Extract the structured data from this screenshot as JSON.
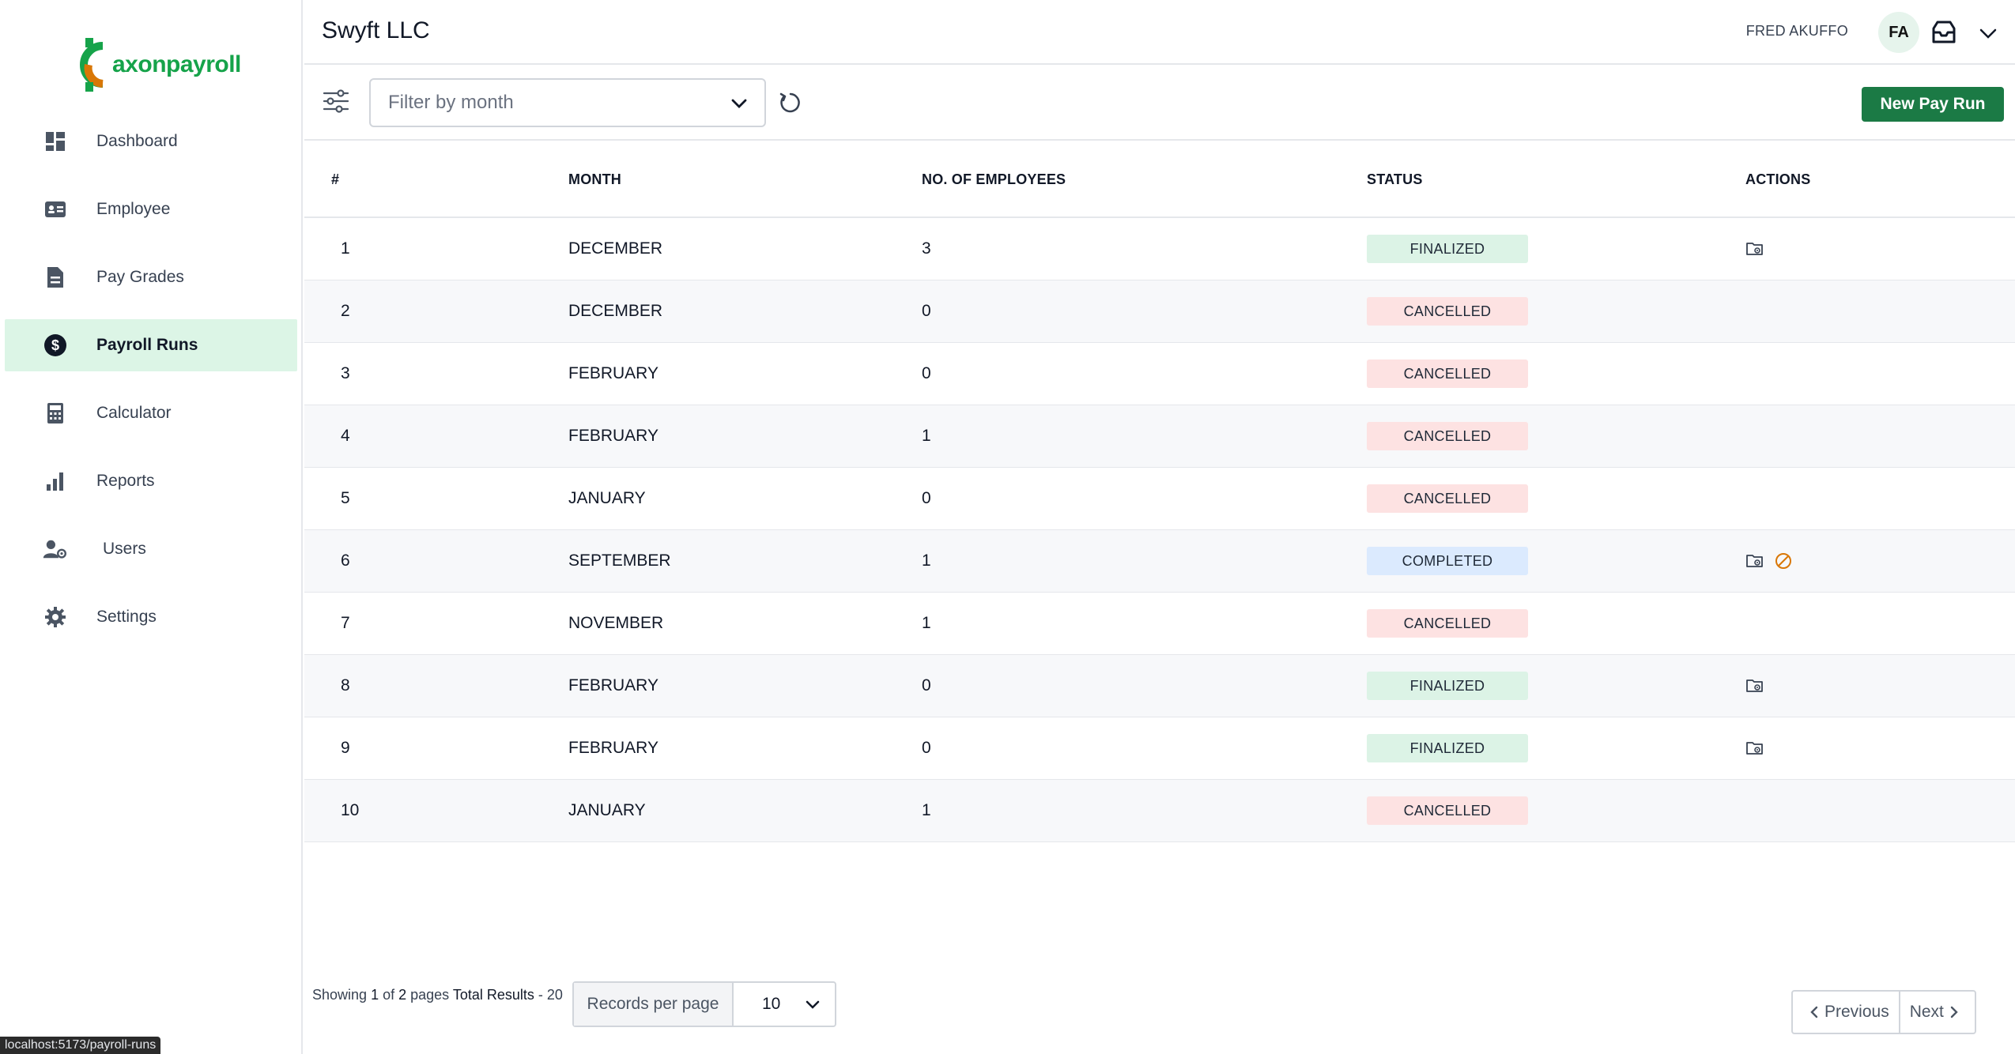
{
  "brand": {
    "logo_text": "axonpayroll",
    "accent": "#16a34a"
  },
  "sidebar": {
    "items": [
      {
        "label": "Dashboard",
        "icon": "dashboard-icon",
        "active": false
      },
      {
        "label": "Employee",
        "icon": "id-card-icon",
        "active": false
      },
      {
        "label": "Pay Grades",
        "icon": "document-icon",
        "active": false
      },
      {
        "label": "Payroll Runs",
        "icon": "dollar-circle-icon",
        "active": true
      },
      {
        "label": "Calculator",
        "icon": "calculator-icon",
        "active": false
      },
      {
        "label": "Reports",
        "icon": "bar-chart-icon",
        "active": false
      },
      {
        "label": "Users",
        "icon": "user-gear-icon",
        "active": false
      },
      {
        "label": "Settings",
        "icon": "gear-icon",
        "active": false
      }
    ],
    "status_url": "localhost:5173/payroll-runs"
  },
  "header": {
    "company": "Swyft LLC",
    "user_name": "FRED AKUFFO",
    "avatar_initials": "FA"
  },
  "toolbar": {
    "month_placeholder": "Filter by month",
    "new_run_label": "New Pay Run"
  },
  "table": {
    "columns": [
      "#",
      "MONTH",
      "NO. OF EMPLOYEES",
      "STATUS",
      "ACTIONS"
    ],
    "rows": [
      {
        "num": "1",
        "month": "DECEMBER",
        "employees": "3",
        "status": "FINALIZED",
        "status_kind": "finalized",
        "actions": [
          "view-payslips-icon"
        ]
      },
      {
        "num": "2",
        "month": "DECEMBER",
        "employees": "0",
        "status": "CANCELLED",
        "status_kind": "cancelled",
        "actions": []
      },
      {
        "num": "3",
        "month": "FEBRUARY",
        "employees": "0",
        "status": "CANCELLED",
        "status_kind": "cancelled",
        "actions": []
      },
      {
        "num": "4",
        "month": "FEBRUARY",
        "employees": "1",
        "status": "CANCELLED",
        "status_kind": "cancelled",
        "actions": []
      },
      {
        "num": "5",
        "month": "JANUARY",
        "employees": "0",
        "status": "CANCELLED",
        "status_kind": "cancelled",
        "actions": []
      },
      {
        "num": "6",
        "month": "SEPTEMBER",
        "employees": "1",
        "status": "COMPLETED",
        "status_kind": "completed",
        "actions": [
          "view-payslips-icon",
          "cancel-run-icon"
        ]
      },
      {
        "num": "7",
        "month": "NOVEMBER",
        "employees": "1",
        "status": "CANCELLED",
        "status_kind": "cancelled",
        "actions": []
      },
      {
        "num": "8",
        "month": "FEBRUARY",
        "employees": "0",
        "status": "FINALIZED",
        "status_kind": "finalized",
        "actions": [
          "view-payslips-icon"
        ]
      },
      {
        "num": "9",
        "month": "FEBRUARY",
        "employees": "0",
        "status": "FINALIZED",
        "status_kind": "finalized",
        "actions": [
          "view-payslips-icon"
        ]
      },
      {
        "num": "10",
        "month": "JANUARY",
        "employees": "1",
        "status": "CANCELLED",
        "status_kind": "cancelled",
        "actions": []
      }
    ]
  },
  "footer": {
    "showing_prefix": "Showing ",
    "current_page": "1",
    "of_text": " of ",
    "total_pages": "2",
    "pages_text": " pages ",
    "total_label": "Total Results",
    "total_value": " - 20",
    "records_per_page_label": "Records per page",
    "records_per_page_value": "10",
    "previous_label": "Previous",
    "next_label": "Next"
  }
}
